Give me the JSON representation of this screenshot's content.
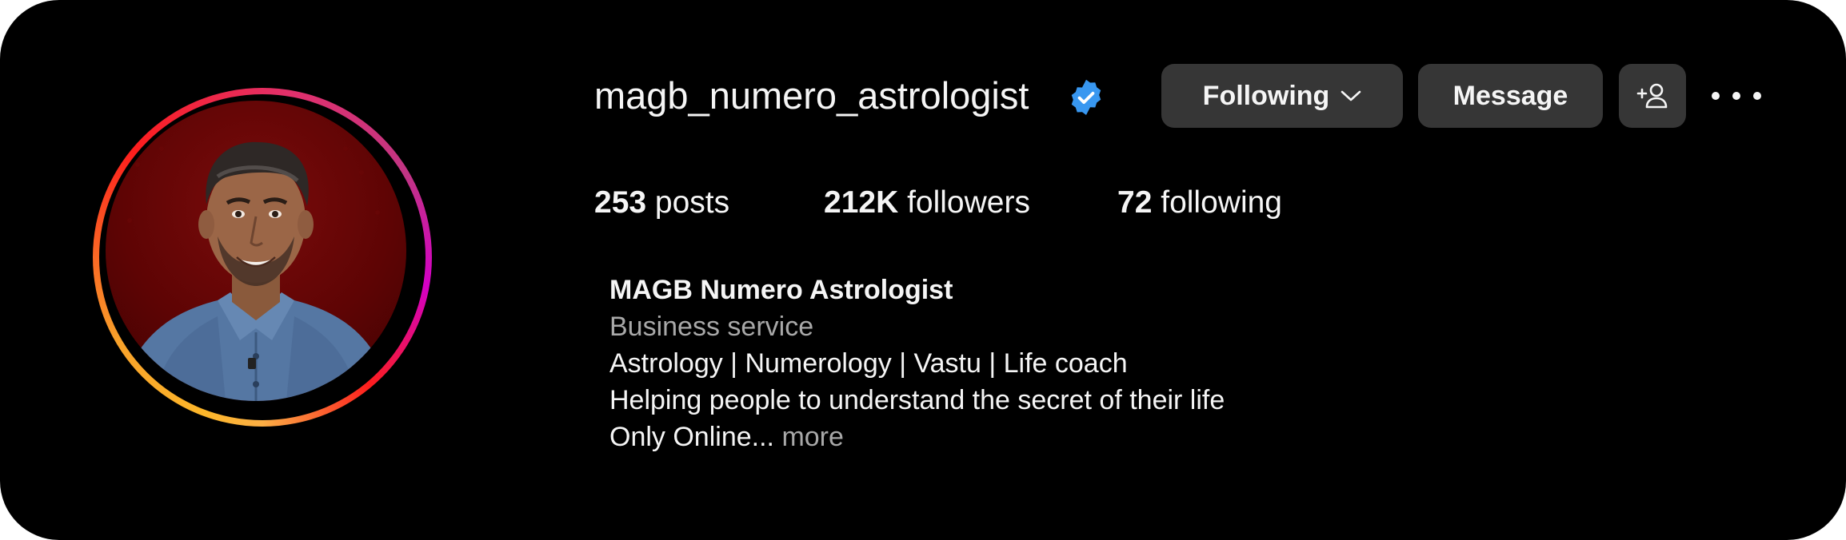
{
  "profile": {
    "username": "magb_numero_astrologist",
    "verified": true,
    "verified_color": "#3897f0",
    "avatar_icon": "profile-photo",
    "avatar_ring_colors": [
      "#fdb72a",
      "#fd1d1d",
      "#e1306c",
      "#c13584",
      "#d300c5"
    ]
  },
  "actions": {
    "following_label": "Following",
    "following_icon": "chevron-down-icon",
    "message_label": "Message",
    "add_user_icon": "add-person-icon",
    "more_icon": "more-horizontal-icon"
  },
  "stats": {
    "posts_count": "253",
    "posts_label": "posts",
    "followers_count": "212K",
    "followers_label": "followers",
    "following_count": "72",
    "following_label": "following"
  },
  "bio": {
    "display_name": "MAGB Numero Astrologist",
    "category": "Business service",
    "lines": [
      "Astrology | Numerology | Vastu | Life coach",
      "Helping people to understand the secret of their life",
      "Only Online..."
    ],
    "more_label": "more"
  },
  "colors": {
    "background": "#000000",
    "button_bg": "#363636",
    "text_primary": "#f5f5f5",
    "text_secondary": "#a8a8a8"
  }
}
